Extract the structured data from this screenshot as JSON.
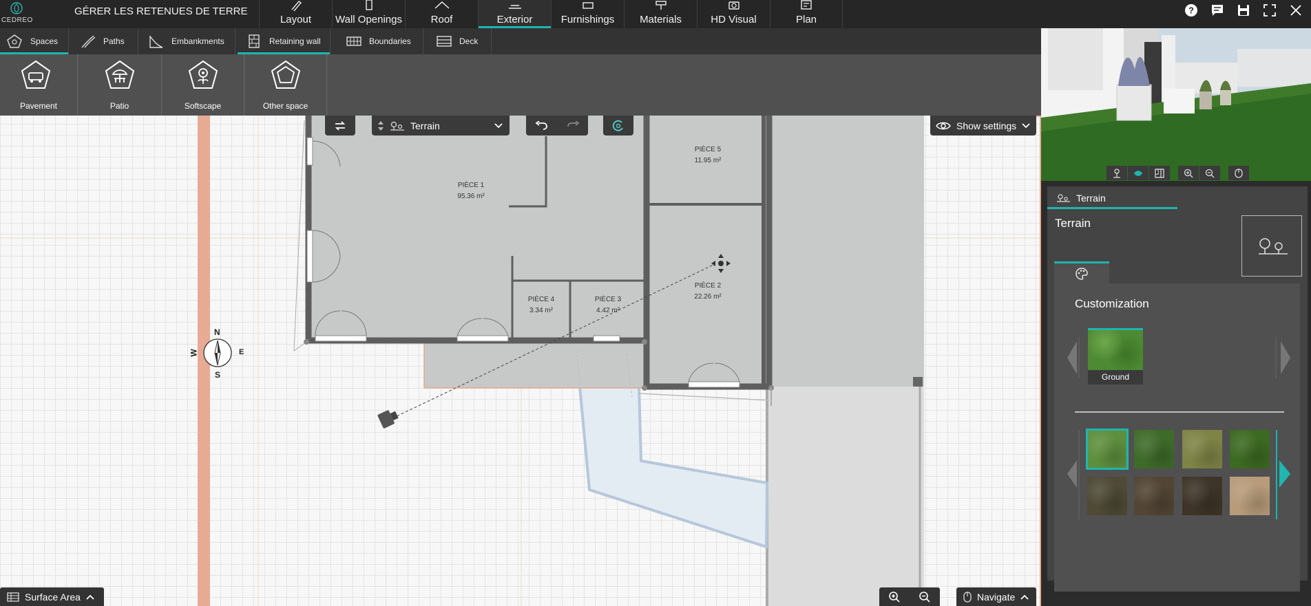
{
  "app": {
    "logo_text": "CEDREO",
    "project_title": "GÉRER LES RETENUES DE TERRE"
  },
  "main_tabs": [
    {
      "label": "Layout",
      "icon": "pencil-icon",
      "active": false
    },
    {
      "label": "Wall Openings",
      "icon": "door-icon",
      "active": false
    },
    {
      "label": "Roof",
      "icon": "roof-icon",
      "active": false
    },
    {
      "label": "Exterior",
      "icon": "exterior-icon",
      "active": true
    },
    {
      "label": "Furnishings",
      "icon": "sofa-icon",
      "active": false
    },
    {
      "label": "Materials",
      "icon": "paint-roller-icon",
      "active": false
    },
    {
      "label": "HD Visual",
      "icon": "camera-icon",
      "active": false
    },
    {
      "label": "Plan",
      "icon": "plan-icon",
      "active": false
    }
  ],
  "top_icons": [
    "help-icon",
    "comment-icon",
    "save-icon",
    "fullscreen-icon",
    "close-icon"
  ],
  "sub_tabs": [
    {
      "label": "Spaces",
      "icon": "spaces-icon",
      "active": true
    },
    {
      "label": "Paths",
      "icon": "paths-icon",
      "active": false
    },
    {
      "label": "Embankments",
      "icon": "embankment-icon",
      "active": false
    },
    {
      "label": "Retaining wall",
      "icon": "retaining-wall-icon",
      "active": true
    },
    {
      "label": "Boundaries",
      "icon": "boundaries-icon",
      "active": false
    },
    {
      "label": "Deck",
      "icon": "deck-icon",
      "active": false
    }
  ],
  "tools": [
    {
      "label": "Pavement",
      "icon": "pavement-icon"
    },
    {
      "label": "Patio",
      "icon": "patio-icon"
    },
    {
      "label": "Softscape",
      "icon": "softscape-icon"
    },
    {
      "label": "Other space",
      "icon": "other-space-icon"
    }
  ],
  "floating_toolbar": {
    "level_select": "Terrain",
    "show_settings": "Show settings"
  },
  "rooms": [
    {
      "name": "PIÈCE 1",
      "area": "95.36 m²"
    },
    {
      "name": "PIÈCE 5",
      "area": "11.95 m²"
    },
    {
      "name": "PIÈCE 2",
      "area": "22.26 m²"
    },
    {
      "name": "PIÈCE 4",
      "area": "3.34 m²"
    },
    {
      "name": "PIÈCE 3",
      "area": "4.42 m²"
    }
  ],
  "compass": {
    "n": "N",
    "s": "S",
    "e": "E",
    "w": "W"
  },
  "right_panel": {
    "tab_label": "Terrain",
    "title": "Terrain",
    "customization_title": "Customization",
    "ground_label": "Ground",
    "swatches": [
      {
        "name": "grass-light",
        "color": "#5e8f3e",
        "selected": true
      },
      {
        "name": "grass-dark",
        "color": "#3f6b2a",
        "selected": false
      },
      {
        "name": "grass-dry",
        "color": "#7e8446",
        "selected": false
      },
      {
        "name": "grass-deep",
        "color": "#3d6a22",
        "selected": false
      },
      {
        "name": "soil-dark",
        "color": "#4e4a36",
        "selected": false
      },
      {
        "name": "soil-rocky",
        "color": "#524535",
        "selected": false
      },
      {
        "name": "soil-black",
        "color": "#3e3528",
        "selected": false
      },
      {
        "name": "sand",
        "color": "#b79b7a",
        "selected": false
      }
    ]
  },
  "bottom": {
    "surface_area": "Surface Area",
    "navigate": "Navigate"
  },
  "colors": {
    "accent": "#1fb5b0",
    "topbar": "#262626",
    "toolbar": "#505050"
  }
}
